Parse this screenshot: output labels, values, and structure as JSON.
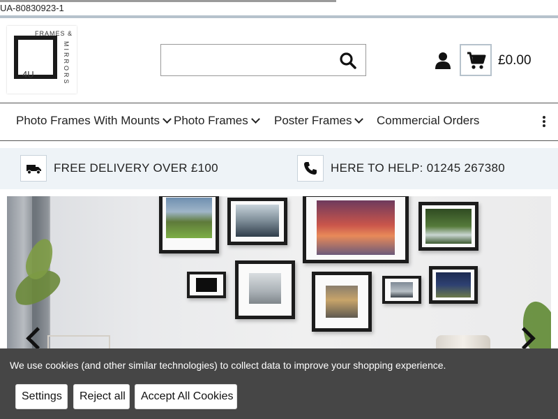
{
  "ua_code": "UA-80830923-1",
  "logo": {
    "line1": "FRAMES &",
    "line2": "MIRRORS",
    "mark": "4U"
  },
  "search": {
    "value": "",
    "placeholder": "",
    "icon": "search-icon"
  },
  "account": {
    "icon": "user-icon"
  },
  "cart": {
    "icon": "cart-icon",
    "total": "£0.00"
  },
  "nav": {
    "items": [
      {
        "label": "Photo Frames With Mounts",
        "has_dropdown": true
      },
      {
        "label": "Photo Frames",
        "has_dropdown": true
      },
      {
        "label": "Poster Frames",
        "has_dropdown": true
      },
      {
        "label": "Commercial Orders",
        "has_dropdown": false
      }
    ],
    "more_icon": "vertical-dots-icon"
  },
  "info_bar": {
    "delivery": {
      "icon": "truck-icon",
      "text": "FREE DELIVERY OVER £100"
    },
    "help": {
      "icon": "phone-icon",
      "text": "HERE TO HELP: 01245 267380"
    }
  },
  "hero": {
    "prev_icon": "chevron-left-icon",
    "next_icon": "chevron-right-icon"
  },
  "cookie_banner": {
    "message": "We use cookies (and other similar technologies) to collect data to improve your shopping experience.",
    "settings_label": "Settings",
    "reject_label": "Reject all",
    "accept_label": "Accept All Cookies"
  },
  "colors": {
    "accent_border": "#b6c2cc",
    "info_bar_bg": "#eef3f7",
    "cookie_bg": "#464646"
  }
}
